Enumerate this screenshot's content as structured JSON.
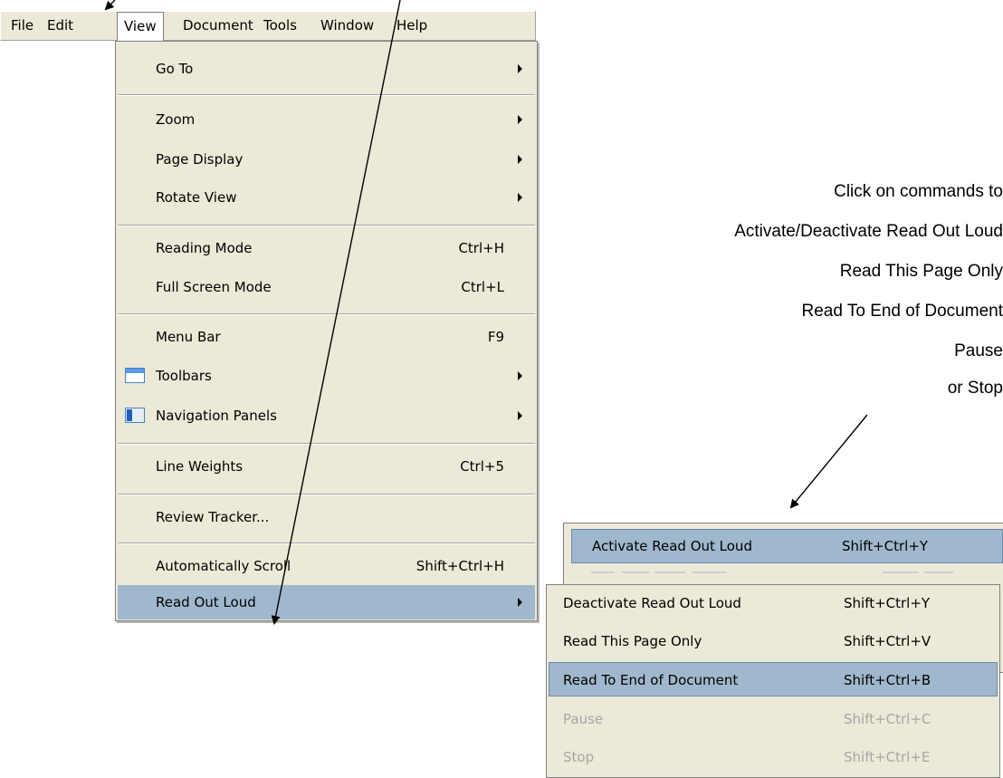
{
  "menubar": {
    "items": [
      "File",
      "Edit",
      "View",
      "Document",
      "Tools",
      "Window",
      "Help"
    ]
  },
  "view_menu": {
    "items": [
      {
        "label": "Go To",
        "shortcut": "",
        "submenu": true
      },
      {
        "label": "Zoom",
        "shortcut": "",
        "submenu": true
      },
      {
        "label": "Page Display",
        "shortcut": "",
        "submenu": true
      },
      {
        "label": "Rotate View",
        "shortcut": "",
        "submenu": true
      },
      {
        "label": "Reading Mode",
        "shortcut": "Ctrl+H",
        "submenu": false
      },
      {
        "label": "Full Screen Mode",
        "shortcut": "Ctrl+L",
        "submenu": false
      },
      {
        "label": "Menu Bar",
        "shortcut": "F9",
        "submenu": false
      },
      {
        "label": "Toolbars",
        "shortcut": "",
        "submenu": true,
        "icon": "toolbars-icon"
      },
      {
        "label": "Navigation Panels",
        "shortcut": "",
        "submenu": true,
        "icon": "navigation-panels-icon"
      },
      {
        "label": "Line Weights",
        "shortcut": "Ctrl+5",
        "submenu": false
      },
      {
        "label": "Review Tracker...",
        "shortcut": "",
        "submenu": false
      },
      {
        "label": "Automatically Scroll",
        "shortcut": "Shift+Ctrl+H",
        "submenu": false
      },
      {
        "label": "Read Out Loud",
        "shortcut": "",
        "submenu": true,
        "highlighted": true
      }
    ]
  },
  "read_out_loud_menu": {
    "items": [
      {
        "label": "Deactivate Read Out Loud",
        "shortcut": "Shift+Ctrl+Y",
        "enabled": true
      },
      {
        "label": "Read This Page Only",
        "shortcut": "Shift+Ctrl+V",
        "enabled": true
      },
      {
        "label": "Read To End of Document",
        "shortcut": "Shift+Ctrl+B",
        "enabled": true,
        "highlighted": true
      },
      {
        "label": "Pause",
        "shortcut": "Shift+Ctrl+C",
        "enabled": false
      },
      {
        "label": "Stop",
        "shortcut": "Shift+Ctrl+E",
        "enabled": false
      }
    ]
  },
  "activate_menu": {
    "label": "Activate Read Out Loud",
    "shortcut": "Shift+Ctrl+Y"
  },
  "caption": {
    "lines": [
      "Click on commands to",
      "Activate/Deactivate Read Out Loud",
      "Read This Page Only",
      "Read To End of Document",
      "Pause",
      "or Stop"
    ]
  },
  "colors": {
    "menu_bg": "#ece9d8",
    "highlight": "#9fb8cd",
    "disabled_text": "#a6a6a6"
  }
}
